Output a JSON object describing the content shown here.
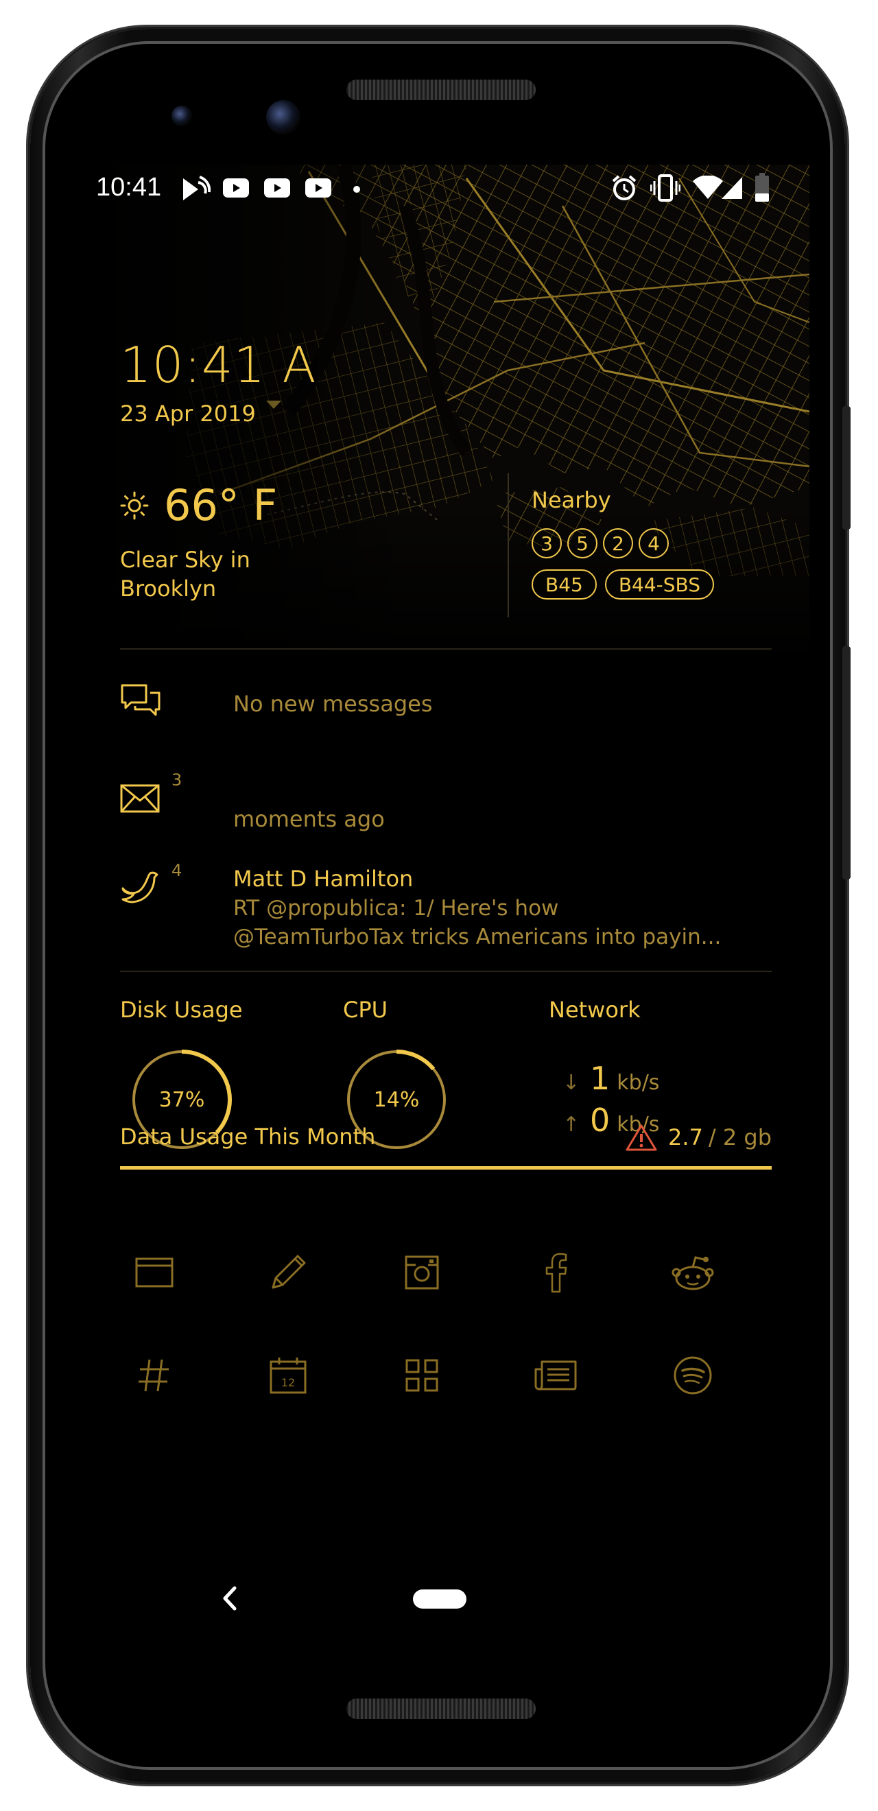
{
  "status_bar": {
    "time": "10:41"
  },
  "clock": {
    "time": "10:41 A",
    "date": "23 Apr 2019"
  },
  "weather": {
    "temperature": "66° F",
    "condition": "Clear Sky in Brooklyn",
    "icon": "sun-icon"
  },
  "nearby": {
    "label": "Nearby",
    "lines_round": [
      "3",
      "5",
      "2",
      "4"
    ],
    "lines_bus": [
      "B45",
      "B44-SBS"
    ]
  },
  "notifications": {
    "messages": {
      "icon": "chat-icon",
      "text": "No new messages"
    },
    "email": {
      "icon": "mail-icon",
      "badge": "3",
      "text": "moments ago"
    },
    "twitter": {
      "icon": "twitter-icon",
      "badge": "4",
      "name": "Matt D Hamilton",
      "body_line1": "RT @propublica: 1/ Here's how",
      "body_line2": "@TeamTurboTax tricks Americans into payin..."
    }
  },
  "stats": {
    "disk": {
      "label": "Disk Usage",
      "value": "37%",
      "fraction": 0.37
    },
    "cpu": {
      "label": "CPU",
      "value": "14%",
      "fraction": 0.14
    },
    "network": {
      "label": "Network",
      "down_value": "1",
      "up_value": "0",
      "unit": "kb/s"
    }
  },
  "data_usage": {
    "label": "Data Usage This Month",
    "used": "2.7",
    "total": "/ 2 gb",
    "fraction": 1.0
  },
  "apps": [
    {
      "name": "browser-icon"
    },
    {
      "name": "pencil-icon"
    },
    {
      "name": "instagram-icon"
    },
    {
      "name": "facebook-icon"
    },
    {
      "name": "reddit-icon"
    },
    {
      "name": "slack-hash-icon"
    },
    {
      "name": "calendar-icon",
      "day": "12"
    },
    {
      "name": "grid-apps-icon"
    },
    {
      "name": "news-icon"
    },
    {
      "name": "spotify-icon"
    }
  ],
  "colors": {
    "accent": "#f2c94c",
    "muted": "#a88a3a",
    "warning": "#e0553a",
    "background": "#000000"
  }
}
